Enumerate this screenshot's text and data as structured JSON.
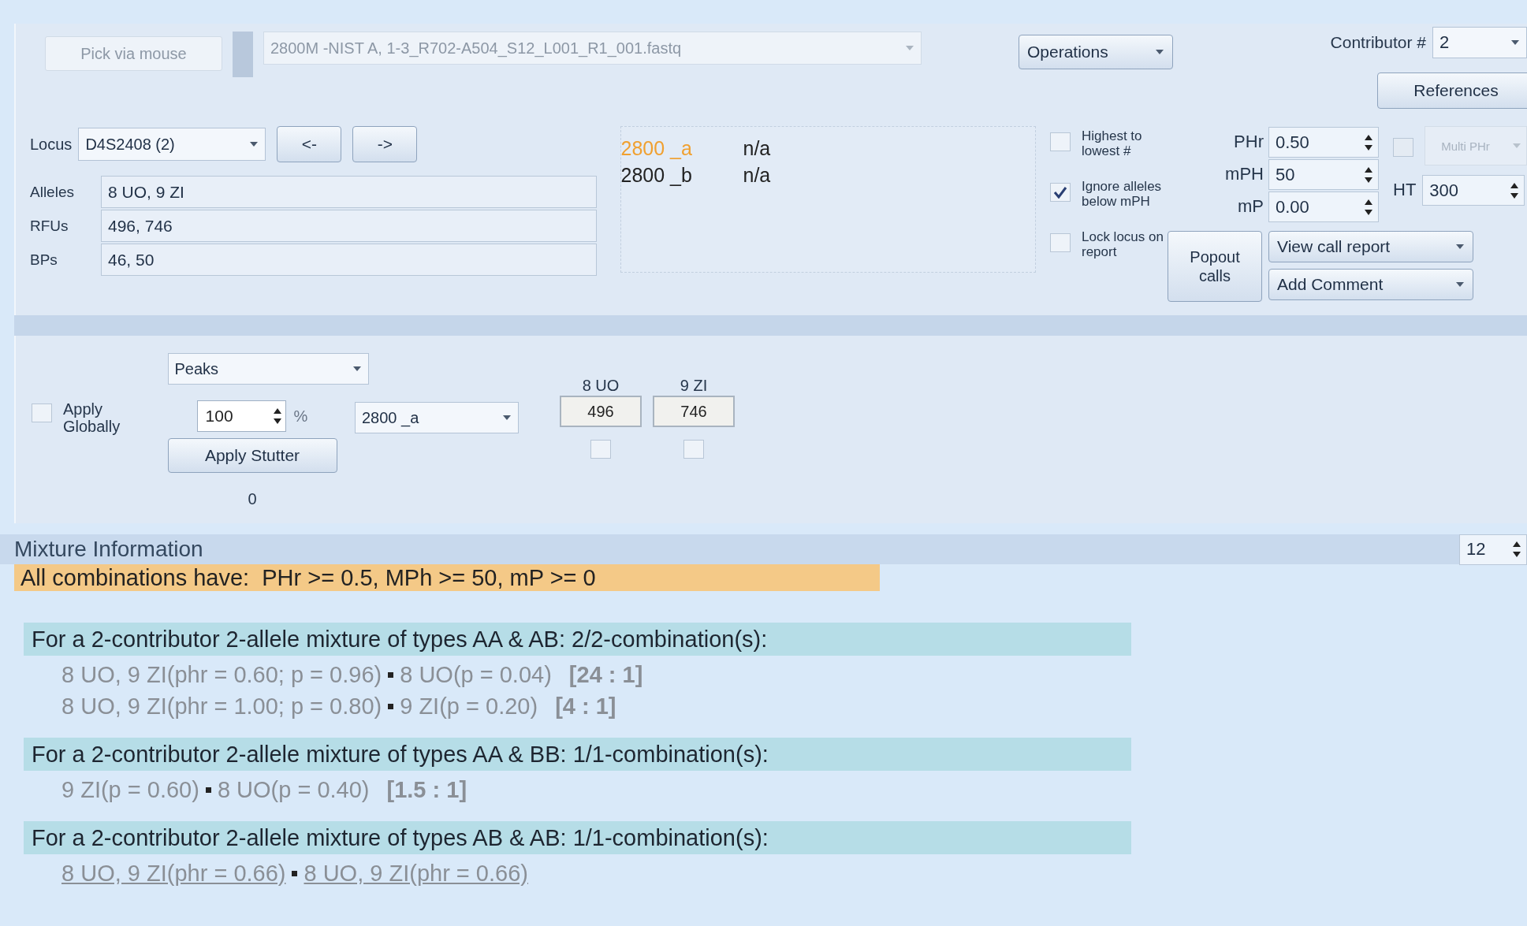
{
  "toolbar": {
    "pick_button": "Pick via mouse",
    "file": "2800M -NIST A, 1-3_R702-A504_S12_L001_R1_001.fastq",
    "operations": "Operations",
    "contributor_label": "Contributor #",
    "contributor": "2",
    "references": "References"
  },
  "locus": {
    "label": "Locus",
    "value": "D4S2408 (2)",
    "prev": "<-",
    "next": "->"
  },
  "allele_fields": [
    {
      "label": "Alleles",
      "value": "8 UO, 9 ZI"
    },
    {
      "label": "RFUs",
      "value": "496, 746"
    },
    {
      "label": "BPs",
      "value": "46, 50"
    }
  ],
  "samples": [
    {
      "name": "2800 _a",
      "call": "n/a",
      "selected": true
    },
    {
      "name": "2800 _b",
      "call": "n/a",
      "selected": false
    }
  ],
  "options": [
    {
      "label": "Highest to lowest #",
      "checked": false
    },
    {
      "label": "Ignore alleles below mPH",
      "checked": true
    },
    {
      "label": "Lock locus on report",
      "checked": false
    }
  ],
  "thresholds": [
    {
      "label": "PHr",
      "value": "0.50"
    },
    {
      "label": "mPH",
      "value": "50"
    },
    {
      "label": "mP",
      "value": "0.00"
    }
  ],
  "multi_phr": {
    "label": "Multi PHr",
    "checked": false,
    "disabled": true
  },
  "ht": {
    "label": "HT",
    "value": "300"
  },
  "actions": {
    "popout": "Popout calls",
    "view_report": "View call report",
    "add_comment": "Add Comment"
  },
  "stutter": {
    "apply_globally": {
      "label": "Apply Globally",
      "checked": false
    },
    "mode": "Peaks",
    "percent": "100",
    "percent_unit": "%",
    "sample": "2800 _a",
    "button": "Apply Stutter",
    "count": "0"
  },
  "peaks": [
    {
      "allele": "8 UO",
      "rfu": "496",
      "checked": false
    },
    {
      "allele": "9 ZI",
      "rfu": "746",
      "checked": false
    }
  ],
  "mixture": {
    "title": "Mixture Information",
    "spinner": "12",
    "summary": "All combinations have:  PHr >= 0.5, MPh >= 50, mP >= 0",
    "groups": [
      {
        "heading": "For a 2-contributor 2-allele mixture of types AA & AB: 2/2-combination(s):",
        "combinations": [
          {
            "kind": "plain",
            "parts": [
              "8 UO, 9 ZI(phr = 0.60; p = 0.96)",
              "8 UO(p = 0.04)"
            ],
            "ratio": "[24 : 1]"
          },
          {
            "kind": "plain",
            "parts": [
              "8 UO, 9 ZI(phr = 1.00; p = 0.80)",
              "9 ZI(p = 0.20)"
            ],
            "ratio": "[4 : 1]"
          }
        ]
      },
      {
        "heading": "For a 2-contributor 2-allele mixture of types AA & BB: 1/1-combination(s):",
        "combinations": [
          {
            "kind": "plain",
            "parts": [
              "9 ZI(p = 0.60)",
              "8 UO(p = 0.40)"
            ],
            "ratio": "[1.5 : 1]"
          }
        ]
      },
      {
        "heading": "For a 2-contributor 2-allele mixture of types AB & AB: 1/1-combination(s):",
        "combinations": [
          {
            "kind": "link",
            "parts": [
              "8 UO, 9 ZI(phr = 0.66)",
              "8 UO, 9 ZI(phr = 0.66)"
            ]
          }
        ]
      }
    ]
  }
}
